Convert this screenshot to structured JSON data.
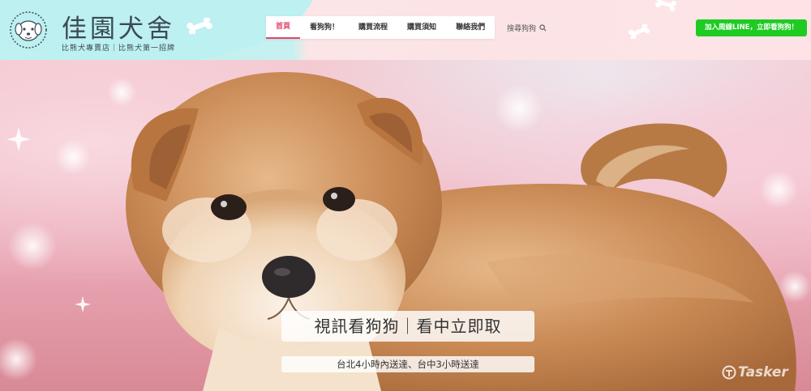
{
  "brand": {
    "title": "佳園犬舍",
    "subtitle": "比熊犬專賣店｜比熊犬第一招牌"
  },
  "nav": {
    "items": [
      {
        "label": "首頁",
        "active": true
      },
      {
        "label": "看狗狗！",
        "active": false
      },
      {
        "label": "購買流程",
        "active": false
      },
      {
        "label": "購買須知",
        "active": false
      },
      {
        "label": "聯絡我們",
        "active": false
      }
    ],
    "search_label": "搜尋狗狗",
    "search_icon": "search-icon"
  },
  "cta": {
    "label": "加入周線LINE，立即看狗狗！"
  },
  "hero": {
    "headline": "視訊看狗狗｜看中立即取",
    "subline": "台北4小時內送達、台中3小時送達"
  },
  "watermark": {
    "text": "Tasker"
  },
  "colors": {
    "accent": "#e2456a",
    "cta": "#1fcb22",
    "header_left": "#bff1f1",
    "header_right": "#fde3e5"
  }
}
